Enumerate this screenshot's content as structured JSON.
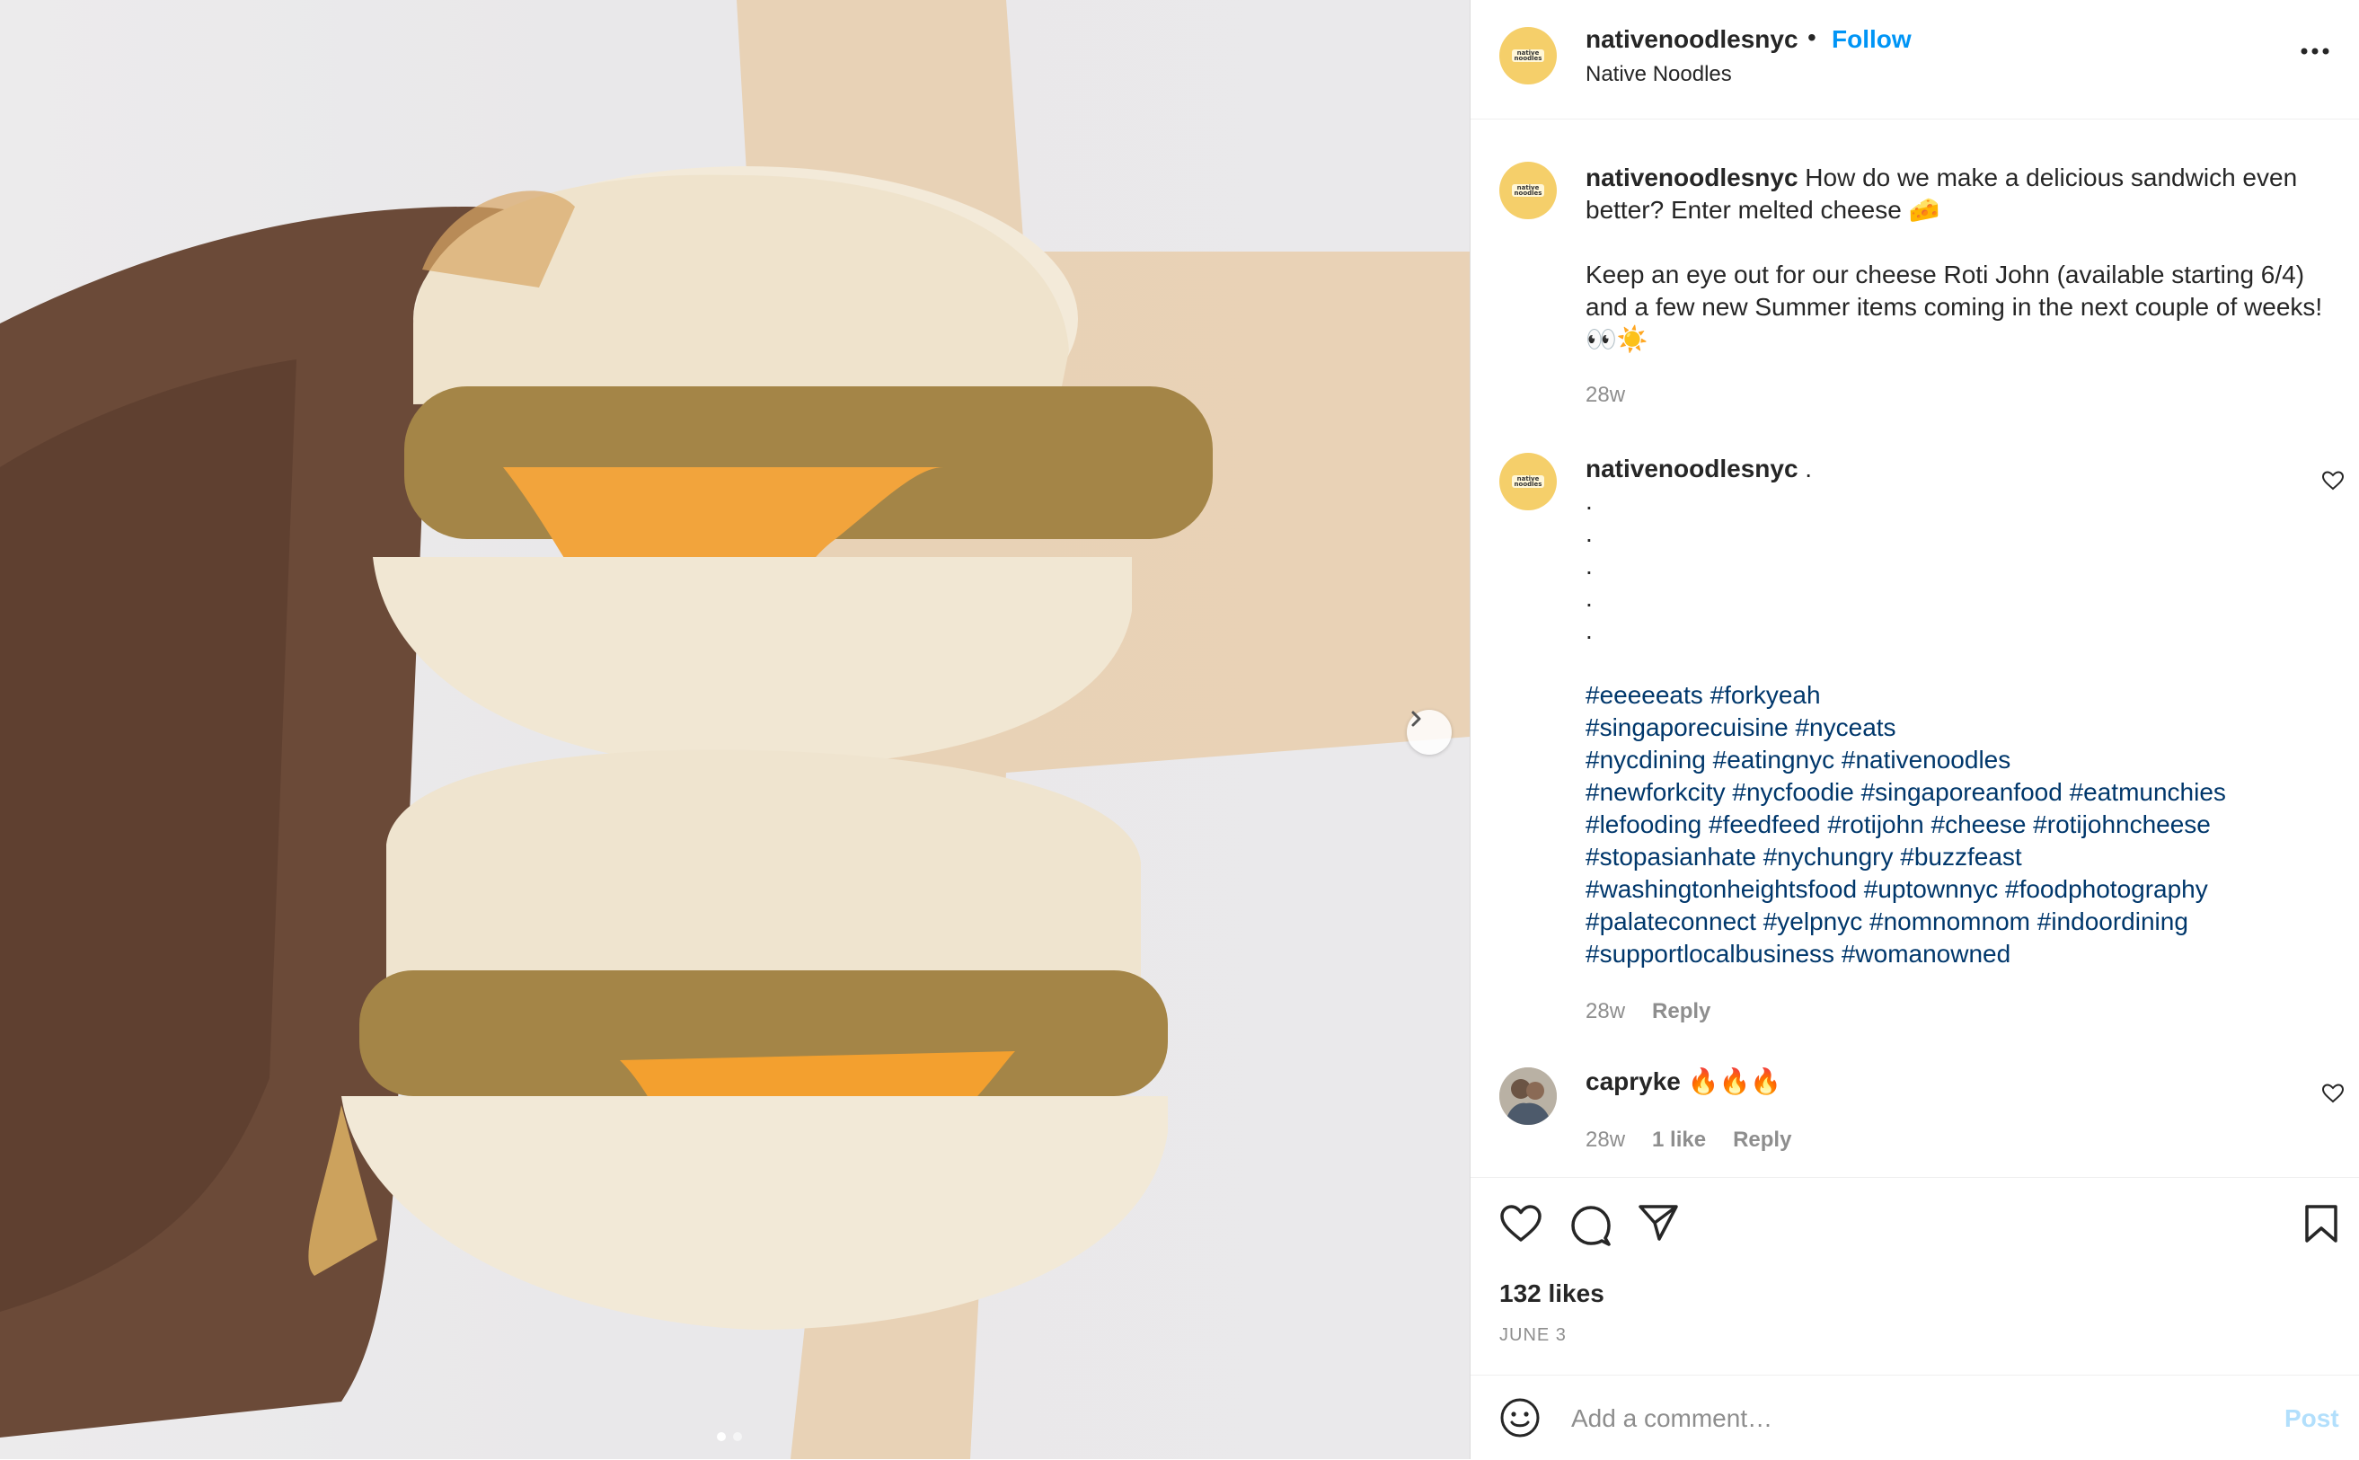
{
  "media": {
    "alt_subject": "",
    "carousel_dots": 2,
    "active_dot": 0,
    "next_icon": "chevron-right-icon"
  },
  "post": {
    "username": "nativenoodlesnyc",
    "separator": "•",
    "follow_label": "Follow",
    "location": "Native Noodles",
    "avatar_badge": "native noodles",
    "more_icon": "more-horizontal-icon"
  },
  "caption": {
    "username": "nativenoodlesnyc",
    "line1": " How do we make a delicious sandwich even better? Enter melted cheese 🧀",
    "line2": "Keep an eye out for our cheese Roti John (available starting 6/4) and a few new Summer items coming in the next couple of weeks! 👀☀️",
    "time": "28w"
  },
  "comments": [
    {
      "username": "nativenoodlesnyc",
      "text": " .",
      "dots": [
        ".",
        ".",
        ".",
        ".",
        "."
      ],
      "hashtags": [
        "#eeeeeats #forkyeah",
        "#singaporecuisine #nyceats",
        "#nycdining #eatingnyc #nativenoodles",
        "#newforkcity #nycfoodie #singaporeanfood #eatmunchies",
        "#lefooding #feedfeed #rotijohn #cheese #rotijohncheese",
        "#stopasianhate #nychungry #buzzfeast",
        "#washingtonheightsfood #uptownnyc #foodphotography",
        "#palateconnect #yelpnyc #nomnomnom #indoordining",
        "#supportlocalbusiness #womanowned"
      ],
      "time": "28w",
      "reply": "Reply"
    },
    {
      "username": "capryke",
      "text": " 🔥🔥🔥",
      "time": "28w",
      "likes": "1 like",
      "reply": "Reply"
    }
  ],
  "actions": {
    "like_icon": "heart-icon",
    "comment_icon": "comment-icon",
    "share_icon": "share-icon",
    "save_icon": "bookmark-icon"
  },
  "likes": "132 likes",
  "date": "JUNE 3",
  "add_comment": {
    "placeholder": "Add a comment…",
    "post_label": "Post",
    "emoji_icon": "emoji-icon"
  },
  "colors": {
    "link": "#0095f6",
    "hashtag": "#00376b",
    "muted": "#8e8e8e",
    "post_disabled": "#b2dffc",
    "avatar_bg": "#f5cf6a"
  }
}
